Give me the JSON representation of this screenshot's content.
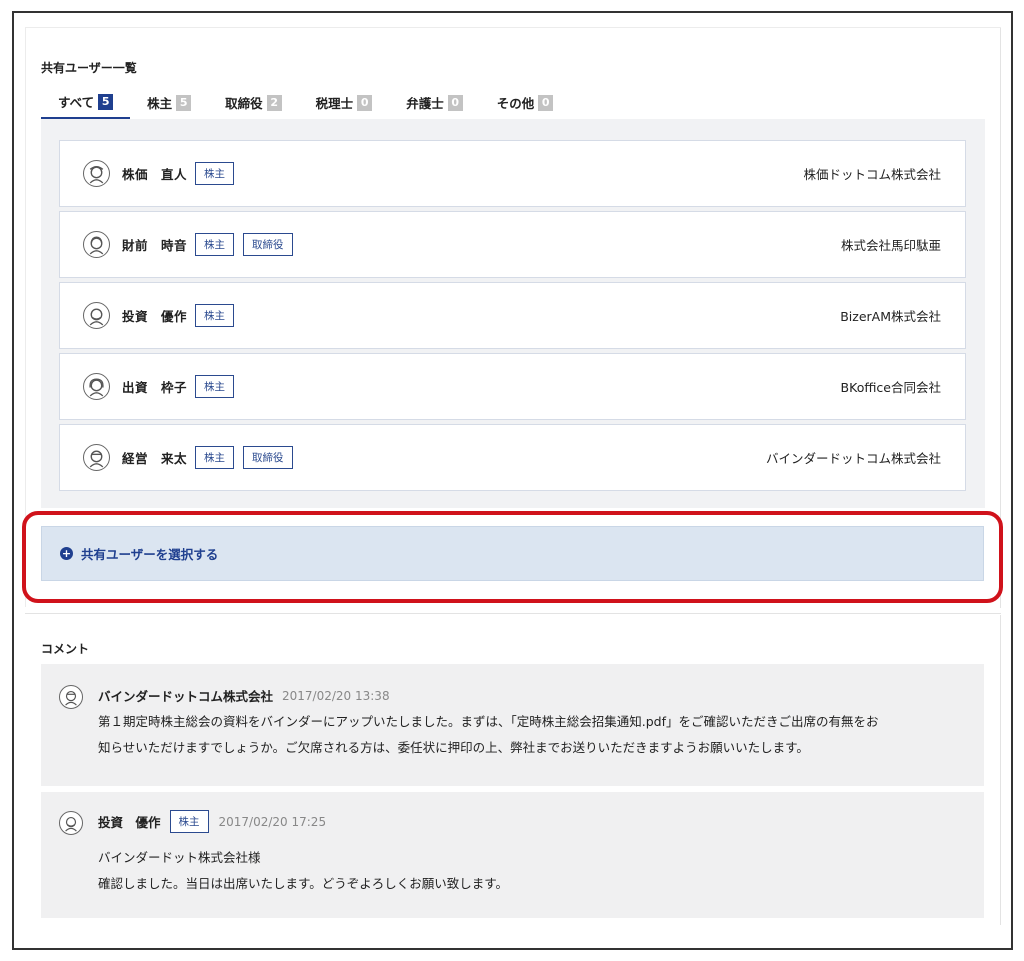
{
  "shared_users": {
    "title": "共有ユーザー一覧",
    "tabs": [
      {
        "label": "すべて",
        "count": "5",
        "active": true
      },
      {
        "label": "株主",
        "count": "5"
      },
      {
        "label": "取締役",
        "count": "2"
      },
      {
        "label": "税理士",
        "count": "0"
      },
      {
        "label": "弁護士",
        "count": "0"
      },
      {
        "label": "その他",
        "count": "0"
      }
    ],
    "users": [
      {
        "name": "株価　直人",
        "roles": [
          "株主"
        ],
        "company": "株価ドットコム株式会社"
      },
      {
        "name": "財前　時音",
        "roles": [
          "株主",
          "取締役"
        ],
        "company": "株式会社馬印駄亜"
      },
      {
        "name": "投資　優作",
        "roles": [
          "株主"
        ],
        "company": "BizerAM株式会社"
      },
      {
        "name": "出資　枠子",
        "roles": [
          "株主"
        ],
        "company": "BKoffice合同会社"
      },
      {
        "name": "経営　来太",
        "roles": [
          "株主",
          "取締役"
        ],
        "company": "バインダードットコム株式会社"
      }
    ],
    "select_button": {
      "icon": "plus-circle-icon",
      "label": "共有ユーザーを選択する"
    }
  },
  "comments": {
    "title": "コメント",
    "items": [
      {
        "author": "バインダードットコム株式会社",
        "time": "2017/02/20 13:38",
        "lines": [
          "第１期定時株主総会の資料をバインダーにアップいたしました。まずは、「定時株主総会招集通知.pdf」をご確認いただきご出席の有無をお",
          "知らせいただけますでしょうか。ご欠席される方は、委任状に押印の上、弊社までお送りいただきますようお願いいたします。"
        ]
      },
      {
        "author": "投資　優作",
        "role": "株主",
        "time": "2017/02/20 17:25",
        "lines": [
          "バインダードット株式会社様",
          "確認しました。当日は出席いたします。どうぞよろしくお願い致します。"
        ]
      }
    ]
  },
  "colors": {
    "accent": "#1f3f8f",
    "highlight": "#d0121b",
    "panel": "#f1f2f4",
    "select_bg": "#dbe5f1"
  }
}
